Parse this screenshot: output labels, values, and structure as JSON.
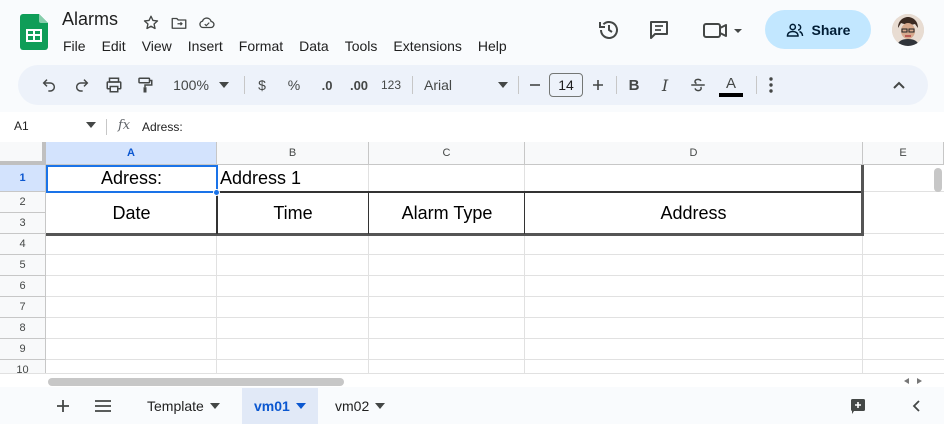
{
  "doc": {
    "title": "Alarms"
  },
  "menu": [
    "File",
    "Edit",
    "View",
    "Insert",
    "Format",
    "Data",
    "Tools",
    "Extensions",
    "Help"
  ],
  "header": {
    "share_label": "Share",
    "accent": "#c2e7ff"
  },
  "toolbar": {
    "zoom": "100%",
    "currency": "$",
    "percent": "%",
    "dec_decrease": ".0",
    "dec_increase": ".00",
    "number_format": "123",
    "font": "Arial",
    "font_size": "14",
    "bold": "B",
    "italic": "I",
    "text_color_letter": "A"
  },
  "formula_bar": {
    "cell_ref": "A1",
    "fx": "fx",
    "value": "Adress:"
  },
  "columns": [
    "A",
    "B",
    "C",
    "D",
    "E"
  ],
  "rows": [
    "1",
    "2",
    "3",
    "4",
    "5",
    "6",
    "7",
    "8",
    "9",
    "10"
  ],
  "cells": {
    "a1": "Adress:",
    "b1": "Address 1",
    "header_date": "Date",
    "header_time": "Time",
    "header_alarm_type": "Alarm Type",
    "header_address": "Address"
  },
  "sheets": [
    {
      "label": "Template",
      "active": false
    },
    {
      "label": "vm01",
      "active": true
    },
    {
      "label": "vm02",
      "active": false
    }
  ]
}
